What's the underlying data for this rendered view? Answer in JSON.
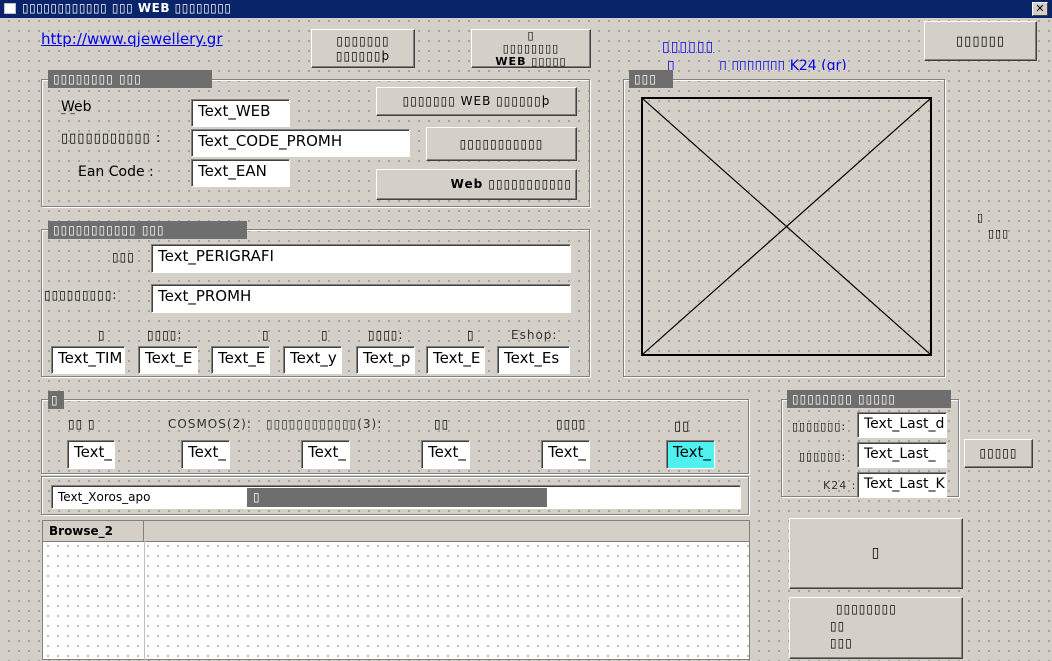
{
  "window": {
    "title": "▯▯▯▯▯▯▯▯▯▯▯▯ ▯▯▯ WEB ▯▯▯▯▯▯▯▯",
    "close": "✕"
  },
  "header": {
    "url_link": "http://www.qjewellery.gr",
    "btn_one": "▯▯▯▯▯▯▯\n▯▯▯▯▯▯þ",
    "btn_two_line1": "▯",
    "btn_two_line2": "▯▯▯▯▯▯▯▯",
    "btn_two_line3": "WEB ▯▯▯▯▯",
    "price_link": "▯▯▯▯▯▯",
    "price_line2_a": "▯",
    "price_line2_b": "▯ ▯▯▯▯▯▯▯ K24 (gr)",
    "exit_button": "▯▯▯▯▯▯"
  },
  "web_group": {
    "title": "▯▯▯▯▯▯▯▯ ▯▯▯",
    "web_label": "Web",
    "web_label_sub": "‾ ‾",
    "web_field": "Text_WEB",
    "code_label": "▯▯▯▯▯▯▯▯▯▯▯ :",
    "code_field": "Text_CODE_PROMH",
    "ean_label": "Ean Code :",
    "ean_field": "Text_EAN",
    "btn_search_web": "▯▯▯▯▯▯▯ WEB ▯▯▯▯▯▯þ",
    "btn_search": "▯▯▯▯▯▯▯▯▯▯▯",
    "btn_web": "Web ▯▯▯▯▯▯▯▯▯▯▯"
  },
  "desc_group": {
    "title": "▯▯▯▯▯▯▯▯▯▯▯ ▯▯▯",
    "perigrafi_label": "▯▯▯",
    "perigrafi_field": "Text_PERIGRAFI",
    "promh_label": "▯▯▯▯▯▯▯▯▯:",
    "promh_field": "Text_PROMH",
    "small_labels": [
      "▯",
      "▯▯▯▯:",
      "▯",
      "▯",
      "▯▯▯▯:",
      "▯",
      "Eshop:"
    ],
    "small_fields": [
      "Text_TIM",
      "Text_E",
      "Text_E",
      "Text_y",
      "Text_p",
      "Text_E",
      "Text_Es"
    ]
  },
  "image_group": {
    "title": "▯▯▯"
  },
  "side_label": {
    "line1": "▯",
    "line2": "▯▯▯"
  },
  "stock_group": {
    "title": "▯",
    "labels": [
      "▯▯ ▯",
      "COSMOS(2):",
      "▯▯▯▯▯▯▯▯▯▯▯▯(3):",
      "▯▯",
      "▯▯▯▯",
      "▯▯"
    ],
    "fields": [
      "Text_",
      "Text_",
      "Text_",
      "Text_",
      "Text_",
      "Text_"
    ],
    "xoros_field": "Text_Xoros_apo",
    "progress_label": "▯"
  },
  "last_group": {
    "title": "▯▯▯▯▯▯▯▯ ▯▯▯▯▯",
    "labels": [
      "▯▯▯▯▯▯▯:",
      "▯▯▯▯▯▯:",
      "K24 :"
    ],
    "fields": [
      "Text_Last_d",
      "Text_Last_",
      "Text_Last_K"
    ],
    "side_button": "▯▯▯▯▯"
  },
  "browse": {
    "column1": "Browse_2"
  },
  "bottom_right": {
    "big_button": "▯",
    "info_line1": "▯▯▯▯▯▯▯▯",
    "info_line2": "▯▯",
    "info_line3": "▯▯▯"
  }
}
